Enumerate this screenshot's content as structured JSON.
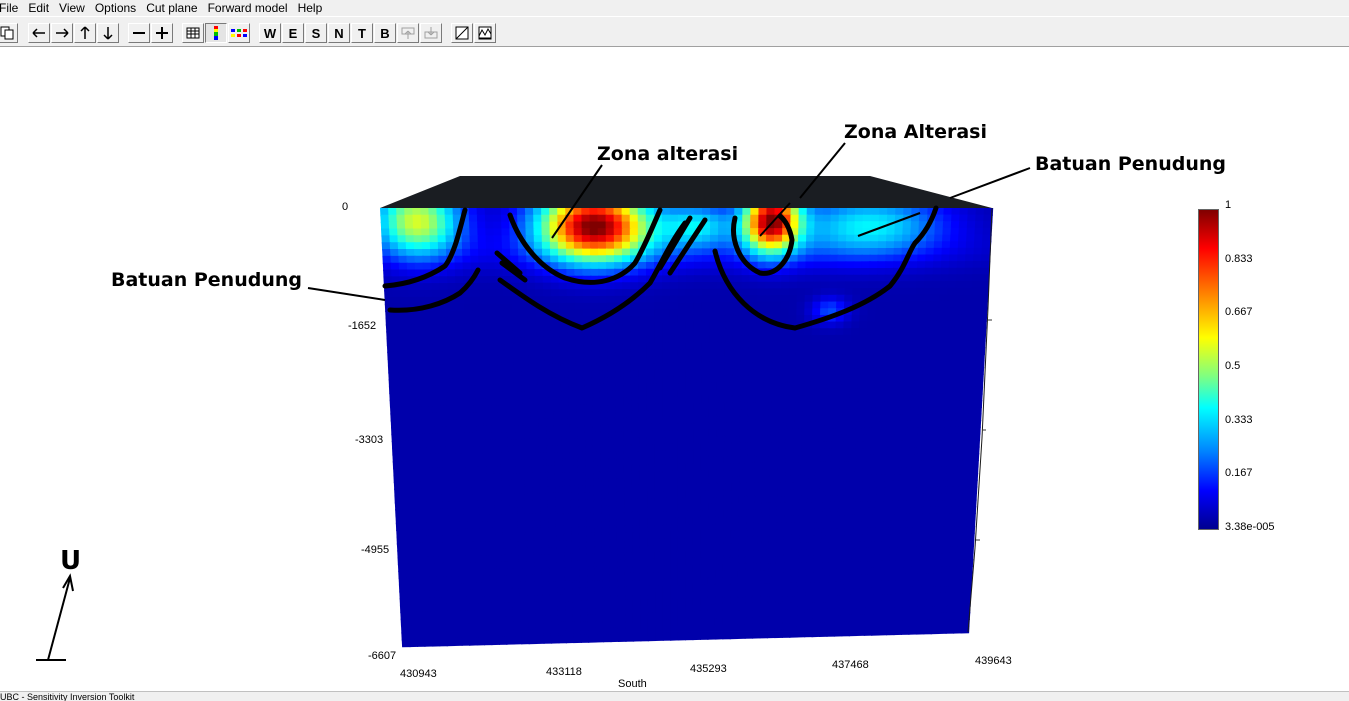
{
  "menubar": {
    "items": [
      {
        "label": "File",
        "accel": "F"
      },
      {
        "label": "Edit",
        "accel": "E"
      },
      {
        "label": "View",
        "accel": "V"
      },
      {
        "label": "Options",
        "accel": "O"
      },
      {
        "label": "Cut plane",
        "accel": "C"
      },
      {
        "label": "Forward model",
        "accel": "F"
      },
      {
        "label": "Help",
        "accel": "H"
      }
    ]
  },
  "toolbar": {
    "w_label": "W",
    "e_label": "E",
    "s_label": "S",
    "n_label": "N",
    "t_label": "T",
    "b_label": "B"
  },
  "plot": {
    "depth_ticks": [
      "0",
      "-1652",
      "-3303",
      "-4955",
      "-6607"
    ],
    "easting_ticks": [
      "430943",
      "433118",
      "435293",
      "437468",
      "439643"
    ],
    "view_direction": "South"
  },
  "colorbar": {
    "ticks": [
      "1",
      "0.833",
      "0.667",
      "0.5",
      "0.333",
      "0.167",
      "3.38e-005"
    ]
  },
  "annotations": {
    "zona_alterasi_1": "Zona alterasi",
    "zona_alterasi_2": "Zona Alterasi",
    "batuan_penudung_left": "Batuan Penudung",
    "batuan_penudung_right": "Batuan Penudung",
    "north_label": "U"
  },
  "statusbar": {
    "text": "UBC - Sensitivity Inversion Toolkit"
  }
}
